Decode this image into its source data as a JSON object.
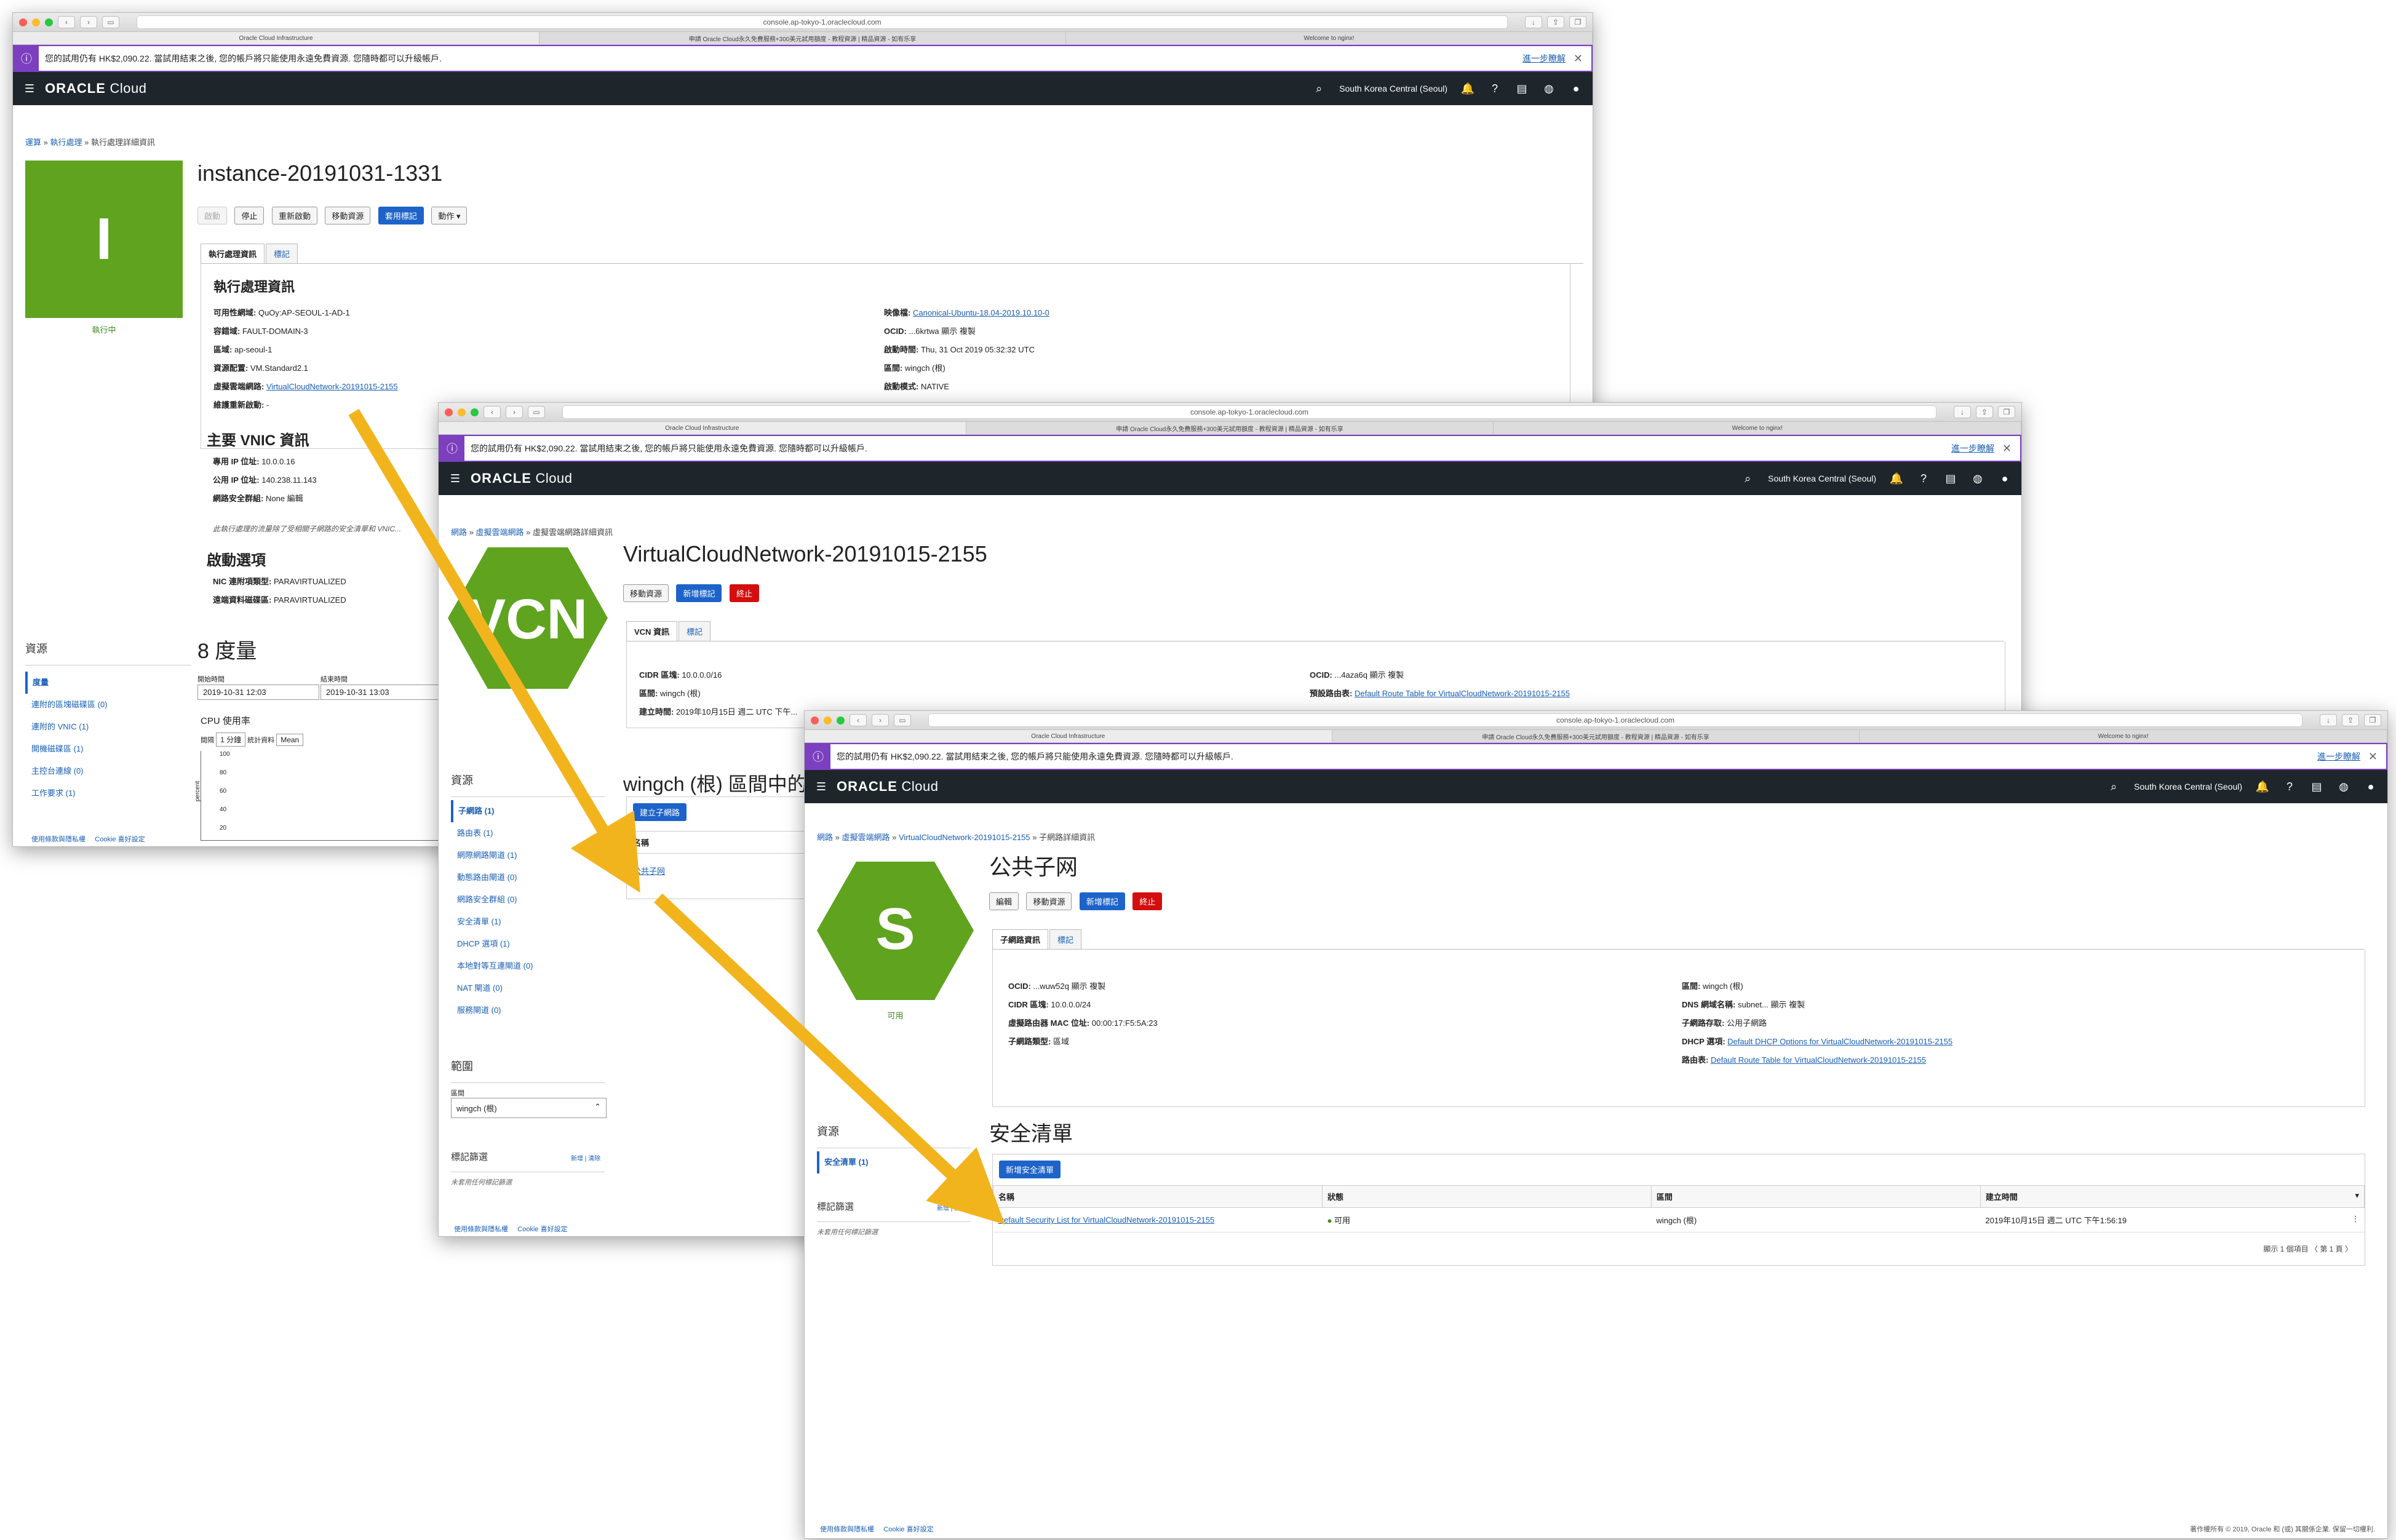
{
  "browser": {
    "url": "console.ap-tokyo-1.oraclecloud.com",
    "tabs": [
      "Oracle Cloud Infrastructure",
      "申請 Oracle Cloud永久免費服務+300美元試用額度 - 教程資源 | 精品資源 - 如有乐享",
      "Welcome to nginx!"
    ]
  },
  "trial": {
    "text": "您的試用仍有 HK$2,090.22. 當試用結束之後, 您的帳戶將只能使用永遠免費資源. 您隨時都可以升級帳戶.",
    "more": "進一步瞭解"
  },
  "navbar": {
    "brand_a": "ORACLE",
    "brand_b": "Cloud",
    "region": "South Korea Central (Seoul)"
  },
  "w1": {
    "crumb_a": "運算",
    "crumb_b": "執行處理",
    "crumb_c": "執行處理詳細資訊",
    "title": "instance-20191031-1331",
    "letter": "I",
    "status": "執行中",
    "buttons": [
      "啟動",
      "停止",
      "重新啟動",
      "移動資源",
      "套用標記",
      "動作 ▾"
    ],
    "tabs": [
      "執行處理資訊",
      "標記"
    ],
    "section": "執行處理資訊",
    "left": [
      {
        "k": "可用性網域:",
        "v": "QuOy:AP-SEOUL-1-AD-1"
      },
      {
        "k": "容錯域:",
        "v": "FAULT-DOMAIN-3"
      },
      {
        "k": "區域:",
        "v": "ap-seoul-1"
      },
      {
        "k": "資源配置:",
        "v": "VM.Standard2.1"
      },
      {
        "k": "虛擬雲端網路:",
        "v": "VirtualCloudNetwork-20191015-2155"
      },
      {
        "k": "維護重新啟動:",
        "v": "-"
      }
    ],
    "right": [
      {
        "k": "映像檔:",
        "v": "Canonical-Ubuntu-18.04-2019.10.10-0"
      },
      {
        "k": "OCID:",
        "v": "...6krtwa 顯示 複製"
      },
      {
        "k": "啟動時間:",
        "v": "Thu, 31 Oct 2019 05:32:32 UTC"
      },
      {
        "k": "區間:",
        "v": "wingch (根)"
      },
      {
        "k": "啟動模式:",
        "v": "NATIVE"
      }
    ],
    "vnic_title": "主要 VNIC 資訊",
    "vnic": [
      {
        "k": "專用 IP 位址:",
        "v": "10.0.0.16"
      },
      {
        "k": "公用 IP 位址:",
        "v": "140.238.11.143"
      },
      {
        "k": "網路安全群組:",
        "v": "None 編輯"
      }
    ],
    "vnic_note": "此執行處理的流量除了受相關子網路的安全清單和 VNIC...",
    "boot_title": "啟動選項",
    "boot": [
      {
        "k": "NIC 連附項類型:",
        "v": "PARAVIRTUALIZED"
      },
      {
        "k": "遠端資料磁碟區:",
        "v": "PARAVIRTUALIZED"
      }
    ],
    "resources_h": "資源",
    "resources": [
      "度量",
      "連附的區塊磁碟區 (0)",
      "連附的 VNIC (1)",
      "開機磁碟區 (1)",
      "主控台連線 (0)",
      "工作要求 (1)"
    ],
    "metrics_title": "8 度量",
    "start_label": "開始時間",
    "end_label": "結束時間",
    "start": "2019-10-31 12:03",
    "end": "2019-10-31 13:03",
    "cpu": "CPU 使用率",
    "interval_label": "間隔",
    "interval": "1 分鐘",
    "stat_label": "統計資料",
    "stat": "Mean",
    "y_label": "percent",
    "yticks": [
      "100",
      "80",
      "60",
      "40",
      "20"
    ],
    "footer": [
      "使用條款與隱私權",
      "Cookie 喜好設定"
    ]
  },
  "w2": {
    "crumb_a": "網路",
    "crumb_b": "虛擬雲端網路",
    "crumb_c": "虛擬雲端網路詳細資訊",
    "title": "VirtualCloudNetwork-20191015-2155",
    "badge": "VCN",
    "buttons": [
      "移動資源",
      "新增標記",
      "終止"
    ],
    "tabs": [
      "VCN 資訊",
      "標記"
    ],
    "left": [
      {
        "k": "CIDR 區塊:",
        "v": "10.0.0.0/16"
      },
      {
        "k": "區間:",
        "v": "wingch (根)"
      },
      {
        "k": "建立時間:",
        "v": "2019年10月15日 週二 UTC 下午..."
      }
    ],
    "right": [
      {
        "k": "OCID:",
        "v": "...4aza6q 顯示 複製"
      },
      {
        "k": "預設路由表:",
        "v": "Default Route Table for VirtualCloudNetwork-20191015-2155"
      }
    ],
    "subnets_title": "wingch (根) 區間中的...",
    "create_subnet": "建立子網路",
    "col_name": "名稱",
    "subnet": "公共子网",
    "resources_h": "資源",
    "resources": [
      "子網路 (1)",
      "路由表 (1)",
      "網際網路閘道 (1)",
      "動態路由閘道 (0)",
      "網路安全群組 (0)",
      "安全清單 (1)",
      "DHCP 選項 (1)",
      "本地對等互連閘道 (0)",
      "NAT 閘道 (0)",
      "服務閘道 (0)"
    ],
    "scope_h": "範圍",
    "compartment_label": "區間",
    "compartment": "wingch (根)",
    "tagfilter_h": "標記篩選",
    "tagfilter_links": "新增 | 清除",
    "tagfilter_note": "未套用任何標記篩選",
    "footer": [
      "使用條款與隱私權",
      "Cookie 喜好設定"
    ]
  },
  "w3": {
    "crumb_a": "網路",
    "crumb_b": "虛擬雲端網路",
    "crumb_c": "VirtualCloudNetwork-20191015-2155",
    "crumb_d": "子網路詳細資訊",
    "title": "公共子网",
    "letter": "S",
    "status": "可用",
    "buttons": [
      "編輯",
      "移動資源",
      "新增標記",
      "終止"
    ],
    "tabs": [
      "子網路資訊",
      "標記"
    ],
    "left": [
      {
        "k": "OCID:",
        "v": "...wuw52q 顯示 複製"
      },
      {
        "k": "CIDR 區塊:",
        "v": "10.0.0.0/24"
      },
      {
        "k": "虛擬路由器 MAC 位址:",
        "v": "00:00:17:F5:5A:23"
      },
      {
        "k": "子網路類型:",
        "v": "區域"
      }
    ],
    "right": [
      {
        "k": "區間:",
        "v": "wingch (根)"
      },
      {
        "k": "DNS 網域名稱:",
        "v": "subnet... 顯示 複製"
      },
      {
        "k": "子網路存取:",
        "v": "公用子網路"
      },
      {
        "k": "DHCP 選項:",
        "v": "Default DHCP Options for VirtualCloudNetwork-20191015-2155"
      },
      {
        "k": "路由表:",
        "v": "Default Route Table for VirtualCloudNetwork-20191015-2155"
      }
    ],
    "sec_title": "安全清單",
    "add_btn": "新增安全清單",
    "cols": [
      "名稱",
      "狀態",
      "區間",
      "建立時間"
    ],
    "row": {
      "name": "Default Security List for VirtualCloudNetwork-20191015-2155",
      "state": "可用",
      "comp": "wingch (根)",
      "time": "2019年10月15日 週二 UTC 下午1:56:19"
    },
    "pager": "顯示 1 個項目   〈  第 1 頁  〉",
    "resources_h": "資源",
    "resources": [
      "安全清單 (1)"
    ],
    "tagfilter_h": "標記篩選",
    "tagfilter_links": "新增 | 清除",
    "tagfilter_note": "未套用任何標記篩選",
    "footer": [
      "使用條款與隱私權",
      "Cookie 喜好設定"
    ],
    "copyright": "著作權所有 © 2019, Oracle 和 (或) 其關係企業. 保留一切權利."
  }
}
